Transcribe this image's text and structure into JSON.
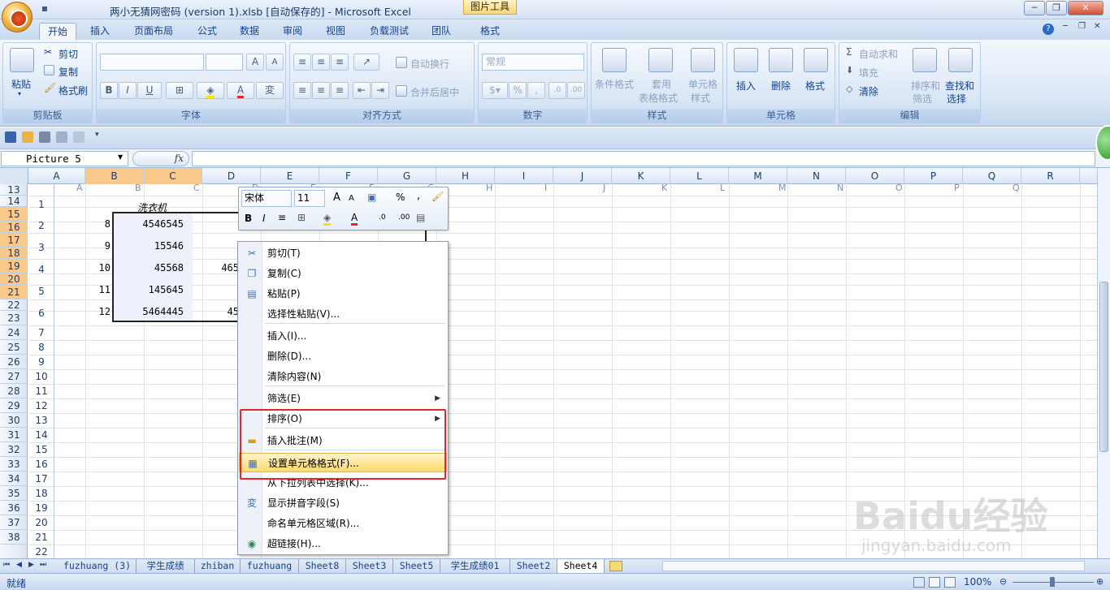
{
  "window": {
    "title": "两小无猜网密码 (version 1).xlsb [自动保存的] - Microsoft Excel",
    "contextual_tab": "图片工具",
    "minimize": "─",
    "restore": "❐",
    "close": "✕"
  },
  "tabs": [
    "开始",
    "插入",
    "页面布局",
    "公式",
    "数据",
    "审阅",
    "视图",
    "负载测试",
    "团队",
    "格式"
  ],
  "ribbon": {
    "clipboard": {
      "title": "剪贴板",
      "paste": "粘贴",
      "cut": "剪切",
      "copy": "复制",
      "format_painter": "格式刷"
    },
    "font": {
      "title": "字体",
      "bold": "B",
      "italic": "I",
      "underline": "U",
      "grow": "A",
      "shrink": "A"
    },
    "alignment": {
      "title": "对齐方式",
      "wrap": "自动换行",
      "merge": "合并后居中"
    },
    "number": {
      "title": "数字",
      "format": "常规",
      "percent": "%"
    },
    "styles": {
      "title": "样式",
      "conditional": "条件格式",
      "table_format_1": "套用",
      "table_format_2": "表格格式",
      "cell_styles_1": "单元格",
      "cell_styles_2": "样式"
    },
    "cells": {
      "title": "单元格",
      "insert": "插入",
      "delete": "删除",
      "format": "格式"
    },
    "editing": {
      "title": "编辑",
      "autosum": "自动求和",
      "fill": "填充",
      "clear": "清除",
      "sort_1": "排序和",
      "sort_2": "筛选",
      "find_1": "查找和",
      "find_2": "选择"
    }
  },
  "namebox": "Picture 5",
  "fx": "fx",
  "col_headers": [
    "A",
    "B",
    "C",
    "D",
    "E",
    "F",
    "G",
    "H",
    "I",
    "J",
    "K",
    "L",
    "M",
    "N",
    "O",
    "P",
    "Q",
    "R"
  ],
  "ghost_cols": [
    "A",
    "B",
    "C",
    "D",
    "E",
    "F",
    "G",
    "H",
    "I",
    "J",
    "K",
    "L",
    "M",
    "N",
    "O",
    "P",
    "Q"
  ],
  "row_headers": [
    "13",
    "14",
    "15",
    "16",
    "17",
    "18",
    "19",
    "20",
    "21",
    "22",
    "23",
    "24",
    "25",
    "26",
    "27",
    "28",
    "29",
    "30",
    "31",
    "32",
    "33",
    "34",
    "35",
    "36",
    "37",
    "38"
  ],
  "ghost_rows": [
    "1",
    "2",
    "3",
    "4",
    "5",
    "6",
    "7",
    "8",
    "9",
    "10",
    "11",
    "12",
    "13",
    "14",
    "15",
    "16",
    "17",
    "18",
    "19",
    "20",
    "21",
    "22"
  ],
  "picture": {
    "header": "洗衣机",
    "col_a": [
      "8",
      "9",
      "10",
      "11",
      "12"
    ],
    "col_b": [
      "4546545",
      "15546",
      "45568",
      "145645",
      "5464445"
    ],
    "col_c": [
      "",
      "",
      "465",
      "",
      "45"
    ]
  },
  "mini_toolbar": {
    "font": "宋体",
    "size": "11",
    "bold": "B",
    "italic": "I",
    "percent": "%",
    "comma": ","
  },
  "context_menu": [
    {
      "label": "剪切(T)",
      "icon": "scissors-icon"
    },
    {
      "label": "复制(C)",
      "icon": "copy-icon"
    },
    {
      "label": "粘贴(P)",
      "icon": "paste-icon"
    },
    {
      "label": "选择性粘贴(V)...",
      "icon": ""
    },
    {
      "label": "插入(I)...",
      "icon": ""
    },
    {
      "label": "删除(D)...",
      "icon": ""
    },
    {
      "label": "清除内容(N)",
      "icon": ""
    },
    {
      "label": "筛选(E)",
      "icon": "",
      "submenu": true
    },
    {
      "label": "排序(O)",
      "icon": "",
      "submenu": true
    },
    {
      "label": "插入批注(M)",
      "icon": "comment-icon"
    },
    {
      "label": "设置单元格格式(F)...",
      "icon": "format-cells-icon"
    },
    {
      "label": "从下拉列表中选择(K)...",
      "icon": ""
    },
    {
      "label": "显示拼音字段(S)",
      "icon": "phonetic-icon"
    },
    {
      "label": "命名单元格区域(R)...",
      "icon": ""
    },
    {
      "label": "超链接(H)...",
      "icon": "hyperlink-icon"
    }
  ],
  "sheets": [
    "fuzhuang (3)",
    "学生成绩",
    "zhiban",
    "fuzhuang",
    "Sheet8",
    "Sheet3",
    "Sheet5",
    "学生成绩01",
    "Sheet2",
    "Sheet4"
  ],
  "status": {
    "ready": "就绪",
    "zoom": "100%"
  },
  "watermark": {
    "brand": "Baidu经验",
    "url": "jingyan.baidu.com"
  },
  "colors": {
    "accent": "#15428b",
    "highlight": "#fcd96a",
    "annotation": "#e2262a"
  }
}
